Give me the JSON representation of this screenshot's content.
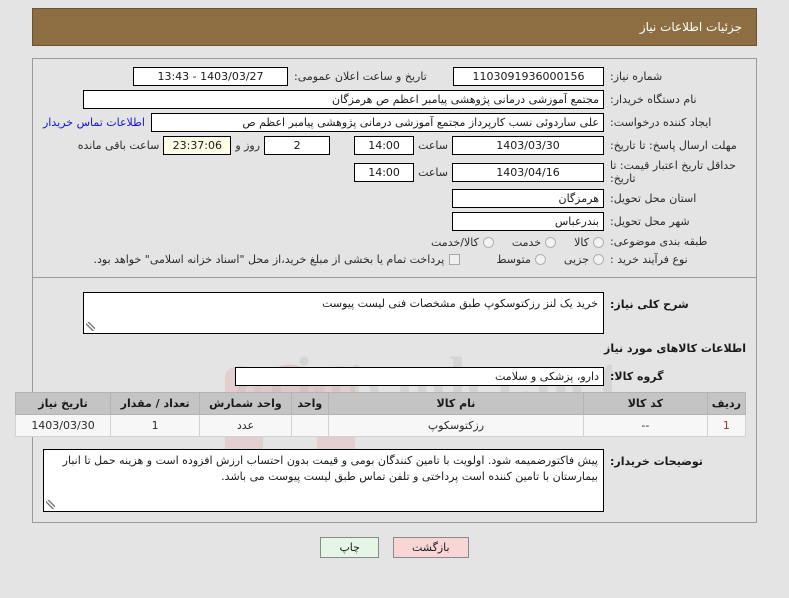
{
  "header": {
    "title": "جزئیات اطلاعات نیاز"
  },
  "watermark": {
    "text": "ariatender.net"
  },
  "top_form": {
    "need_number_label": "شماره نیاز:",
    "need_number_value": "1103091936000156",
    "public_announce_label": "تاریخ و ساعت اعلان عمومی:",
    "public_announce_value": "1403/03/27 - 13:43",
    "buyer_org_label": "نام دستگاه خریدار:",
    "buyer_org_value": "مجتمع آموزشی درمانی پژوهشی پیامبر اعظم ص  هرمزگان",
    "requester_label": "ایجاد کننده درخواست:",
    "requester_value": "علی ساردوئی نسب کارپرداز مجتمع آموزشی درمانی پژوهشی پیامبر اعظم ص",
    "contact_link": "اطلاعات تماس خریدار",
    "reply_deadline_label": "مهلت ارسال پاسخ: تا تاریخ:",
    "reply_deadline_date": "1403/03/30",
    "reply_deadline_time": "14:00",
    "hour_word": "ساعت",
    "remaining_days": "2",
    "remaining_days_sep": "روز و",
    "remaining_countdown": "23:37:06",
    "remaining_suffix": "ساعت باقی مانده",
    "price_validity_label": "حداقل تاریخ اعتبار قیمت: تا تاریخ:",
    "price_validity_date": "1403/04/16",
    "price_validity_time": "14:00",
    "province_label": "استان محل تحویل:",
    "province_value": "هرمزگان",
    "city_label": "شهر محل تحویل:",
    "city_value": "بندرعباس",
    "subject_class_label": "طبقه بندی موضوعی:",
    "subject_class_options": [
      "کالا",
      "خدمت",
      "کالا/خدمت"
    ],
    "purchase_type_label": "نوع فرآیند خرید :",
    "purchase_type_options": [
      "جزیی",
      "متوسط"
    ],
    "treasury_checkbox_label": "پرداخت تمام یا بخشی از مبلغ خرید،از محل \"اسناد خزانه اسلامی\" خواهد بود."
  },
  "description": {
    "label": "شرح کلی نیاز:",
    "value": "خرید یک لنز رزکتوسکوپ طبق مشخصات فنی  لیست  پیوست"
  },
  "goods_section": {
    "title": "اطلاعات کالاهای مورد نیاز",
    "group_label": "گروه کالا:",
    "group_value": "دارو، پزشکی و سلامت",
    "columns": [
      "ردیف",
      "کد کالا",
      "نام کالا",
      "واحد",
      "واحد شمارش",
      "تعداد / مقدار",
      "تاریخ نیاز"
    ],
    "rows": [
      {
        "row_no": "1",
        "code": "--",
        "name": "رزکتوسکوپ",
        "unit_blank": "",
        "count_unit": "عدد",
        "quantity": "1",
        "need_date": "1403/03/30"
      }
    ]
  },
  "buyer_notes": {
    "label": "توضیحات خریدار:",
    "value": "پیش فاکتورضمیمه شود. اولویت با تامین کنندگان بومی و قیمت بدون احتساب ارزش افزوده است و هزینه حمل تا انبار بیمارستان با  تامین کننده است پرداختی و تلفن تماس طبق لیست پیوست می باشد."
  },
  "footer": {
    "print_label": "چاپ",
    "back_label": "بازگشت"
  },
  "colors": {
    "header_bg": "#8d6e43",
    "link": "#1414d2",
    "print_btn": "#e6f6e6",
    "back_btn": "#f9d6d6",
    "countdown_bg": "#fdfde8",
    "table_header_bg": "#c4c4c4"
  }
}
